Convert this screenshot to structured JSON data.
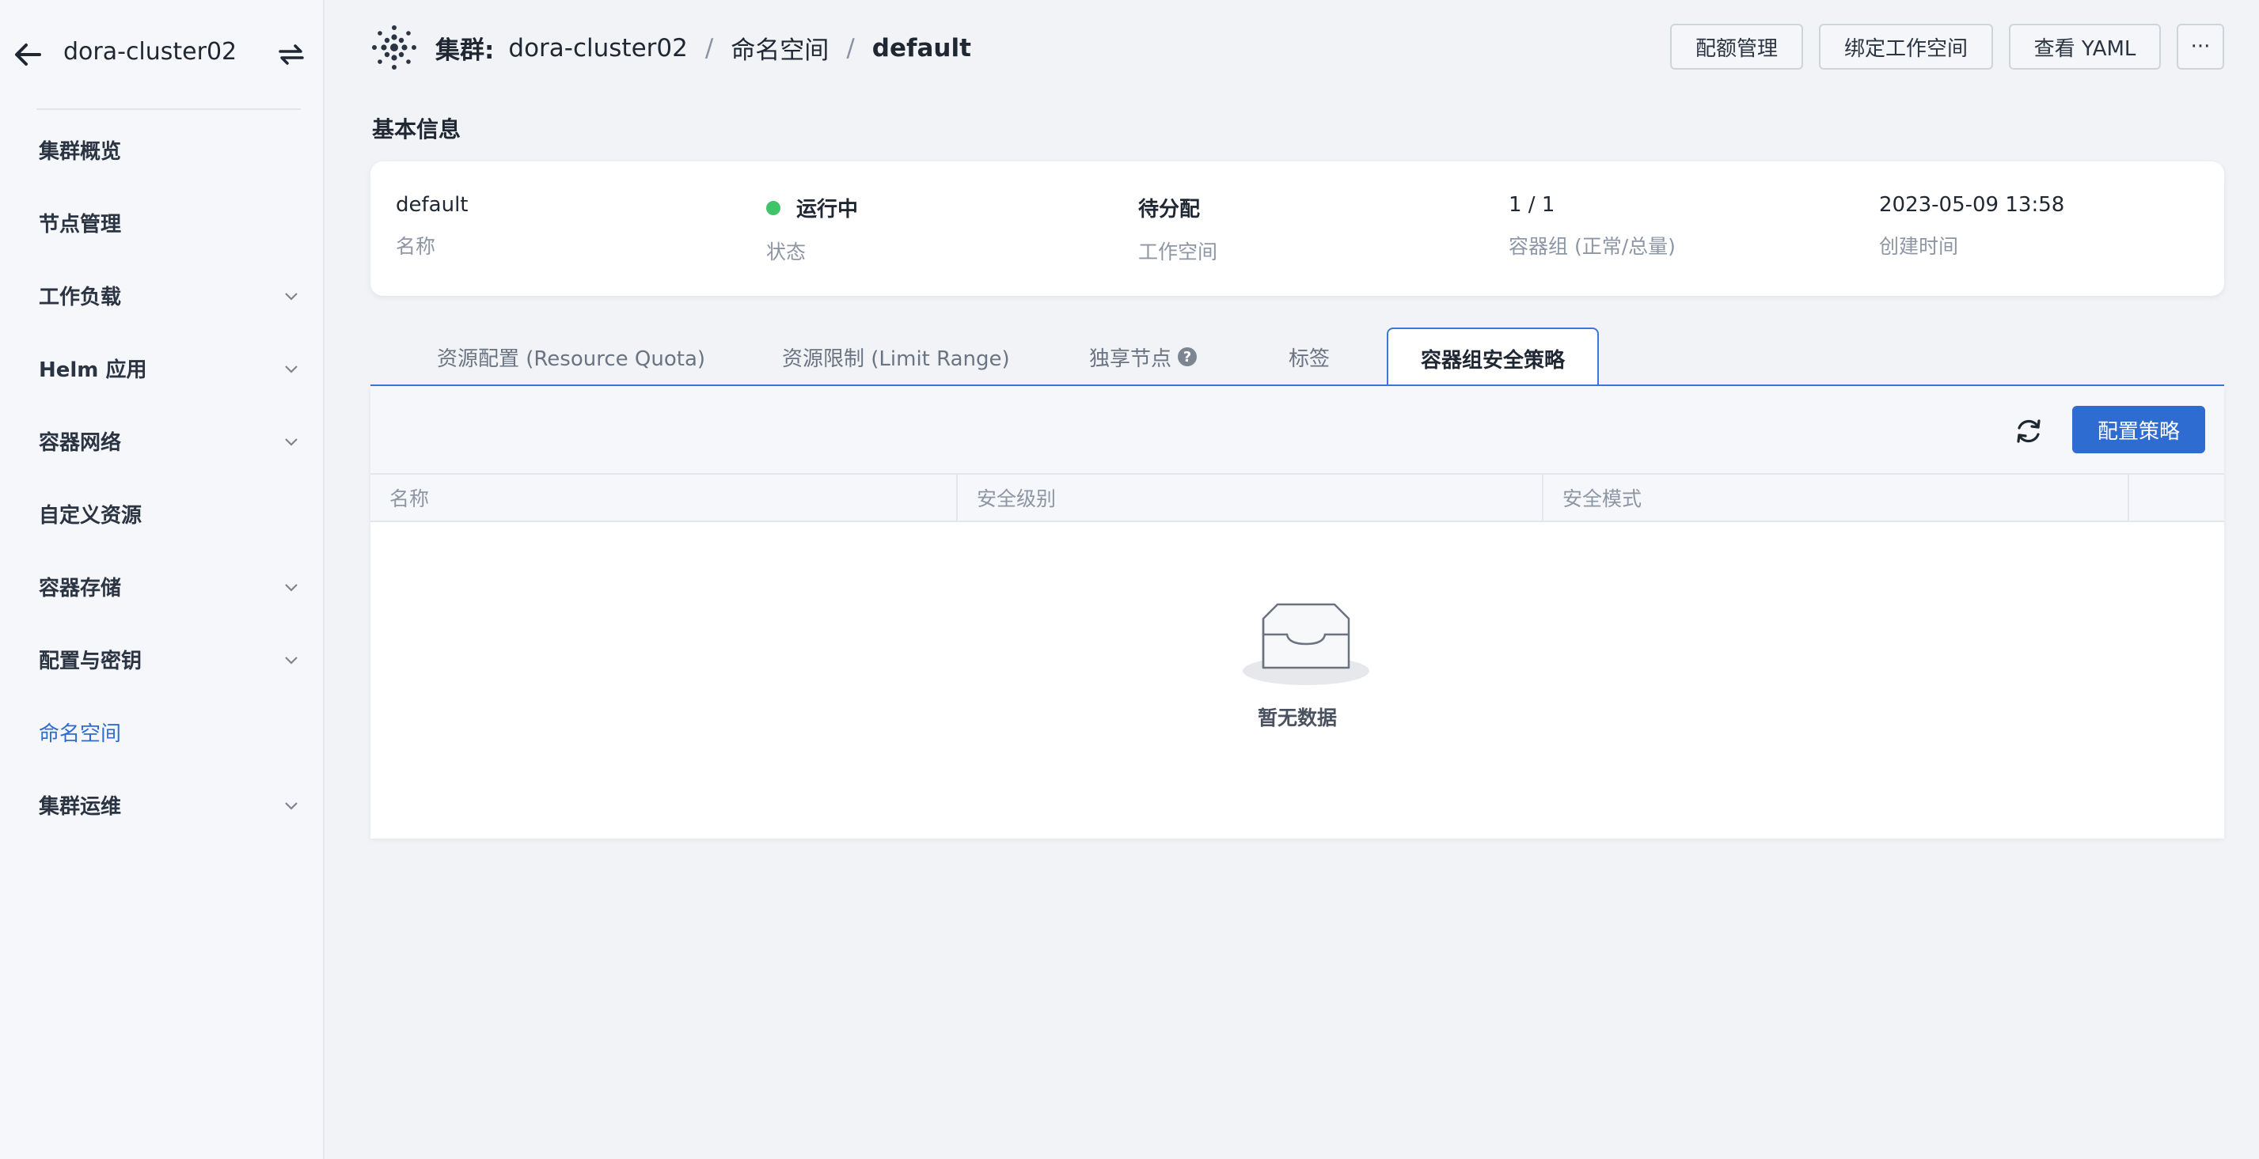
{
  "sidebar": {
    "cluster_name": "dora-cluster02",
    "items": [
      {
        "label": "集群概览",
        "expandable": false,
        "active": false
      },
      {
        "label": "节点管理",
        "expandable": false,
        "active": false
      },
      {
        "label": "工作负载",
        "expandable": true,
        "active": false
      },
      {
        "label": "Helm 应用",
        "expandable": true,
        "active": false
      },
      {
        "label": "容器网络",
        "expandable": true,
        "active": false
      },
      {
        "label": "自定义资源",
        "expandable": false,
        "active": false
      },
      {
        "label": "容器存储",
        "expandable": true,
        "active": false
      },
      {
        "label": "配置与密钥",
        "expandable": true,
        "active": false
      },
      {
        "label": "命名空间",
        "expandable": false,
        "active": true
      },
      {
        "label": "集群运维",
        "expandable": true,
        "active": false
      }
    ]
  },
  "header": {
    "cluster_label": "集群:",
    "cluster_name": "dora-cluster02",
    "separator": "/",
    "namespace_crumb": "命名空间",
    "current": "default",
    "buttons": {
      "quota": "配额管理",
      "bind_workspace": "绑定工作空间",
      "view_yaml": "查看 YAML",
      "more": "···"
    }
  },
  "basic_info": {
    "title": "基本信息",
    "fields": [
      {
        "value": "default",
        "label": "名称"
      },
      {
        "value": "运行中",
        "label": "状态"
      },
      {
        "value": "待分配",
        "label": "工作空间"
      },
      {
        "value": "1 / 1",
        "label": "容器组 (正常/总量)"
      },
      {
        "value": "2023-05-09 13:58",
        "label": "创建时间"
      }
    ],
    "status_color": "#3fc46a"
  },
  "tabs": [
    {
      "label": "资源配置 (Resource Quota)"
    },
    {
      "label": "资源限制 (Limit Range)"
    },
    {
      "label": "独享节点"
    },
    {
      "label": "标签"
    },
    {
      "label": "容器组安全策略"
    }
  ],
  "panel": {
    "configure_button": "配置策略",
    "columns": [
      "名称",
      "安全级别",
      "安全模式"
    ],
    "empty_text": "暂无数据"
  },
  "colors": {
    "accent": "#2f6cd1",
    "tab_border": "#3b78d6"
  }
}
